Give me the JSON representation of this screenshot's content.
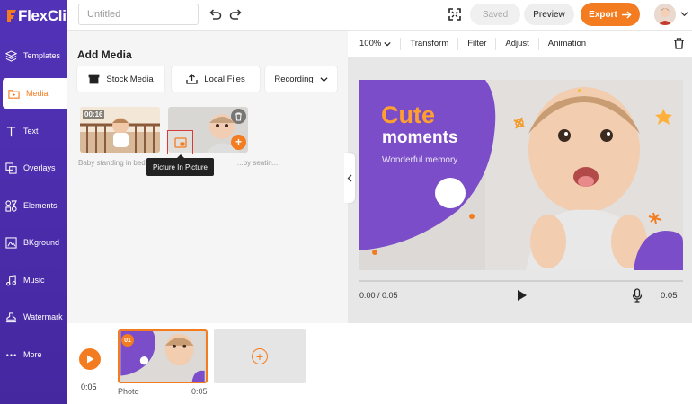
{
  "app": {
    "logo_text": "FlexClip",
    "project_title_placeholder": "Untitled",
    "accent_color": "#f47c20",
    "sidebar_color": "#4a2fa8"
  },
  "sidebar": {
    "items": [
      {
        "label": "Templates",
        "icon": "layers-icon",
        "active": false
      },
      {
        "label": "Media",
        "icon": "folder-icon",
        "active": true
      },
      {
        "label": "Text",
        "icon": "text-icon",
        "active": false
      },
      {
        "label": "Overlays",
        "icon": "overlays-icon",
        "active": false
      },
      {
        "label": "Elements",
        "icon": "elements-icon",
        "active": false
      },
      {
        "label": "BKground",
        "icon": "background-icon",
        "active": false
      },
      {
        "label": "Music",
        "icon": "music-icon",
        "active": false
      },
      {
        "label": "Watermark",
        "icon": "watermark-icon",
        "active": false
      },
      {
        "label": "More",
        "icon": "more-icon",
        "active": false
      }
    ]
  },
  "topbar": {
    "saved_label": "Saved",
    "preview_label": "Preview",
    "export_label": "Export"
  },
  "media_panel": {
    "title": "Add Media",
    "stock_label": "Stock Media",
    "local_label": "Local Files",
    "recording_label": "Recording",
    "items": [
      {
        "duration": "00:16",
        "caption": "Baby standing in bed"
      },
      {
        "caption": "Baby seatin..."
      }
    ],
    "tooltip": "Picture In Picture",
    "caption_overlap": "...by seatin..."
  },
  "editor": {
    "zoom": "100%",
    "tools": [
      "Transform",
      "Filter",
      "Adjust",
      "Animation"
    ],
    "canvas": {
      "title": "Cute",
      "subtitle": "moments",
      "small_text": "Wonderful memory"
    },
    "player": {
      "current": "0:00 / 0:05",
      "end": "0:05"
    }
  },
  "timeline": {
    "total_time": "0:05",
    "clips": [
      {
        "number": "01",
        "name": "Photo",
        "duration": "0:05"
      }
    ]
  }
}
